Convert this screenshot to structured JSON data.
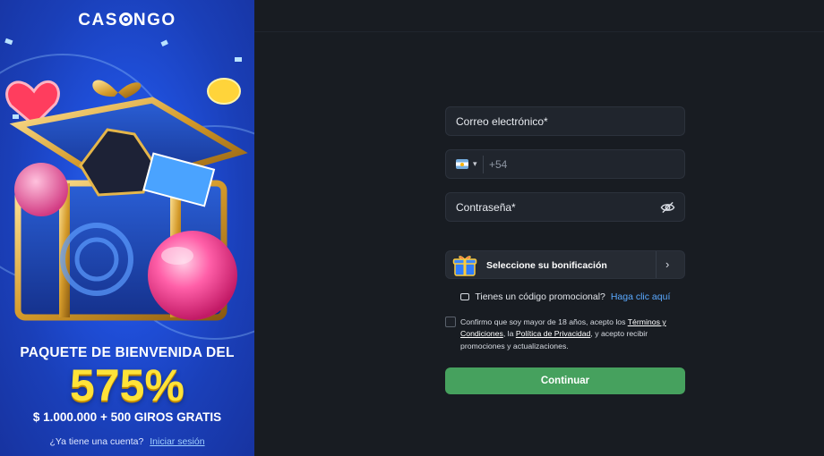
{
  "brand": {
    "logo_text": "CASONGO"
  },
  "promo": {
    "headline": "PAQUETE DE BIENVENIDA DEL",
    "percent": "575%",
    "amount": "$ 1.000.000 + 500 GIROS GRATIS",
    "account_question": "¿Ya tiene una cuenta?",
    "login_link": "Iniciar sesión",
    "illustration_icon": "treasure-chest"
  },
  "form": {
    "email_label": "Correo electrónico*",
    "phone": {
      "country_icon": "argentina-flag-icon",
      "caret": "▾",
      "code": "+54"
    },
    "password_label": "Contraseña*",
    "password_icon": "eye-slash-icon",
    "bonus": {
      "icon": "gift-icon",
      "label": "Seleccione su bonificación",
      "chevron": "›"
    },
    "promo_code": {
      "question": "Tienes un código promocional?",
      "link": "Haga clic aquí"
    },
    "terms": {
      "part1": "Confirmo que soy mayor de 18 años, acepto los ",
      "terms_link": "Términos y Condiciones",
      "part2": ", la ",
      "privacy_link": "Política de Privacidad",
      "part3": ", y acepto recibir promociones y actualizaciones."
    },
    "continue_label": "Continuar"
  },
  "colors": {
    "accent_green": "#46a15e",
    "link_blue": "#5aa9ff",
    "panel_blue": "#1f4ed8",
    "gold": "#ffe238",
    "background": "#181c22"
  }
}
